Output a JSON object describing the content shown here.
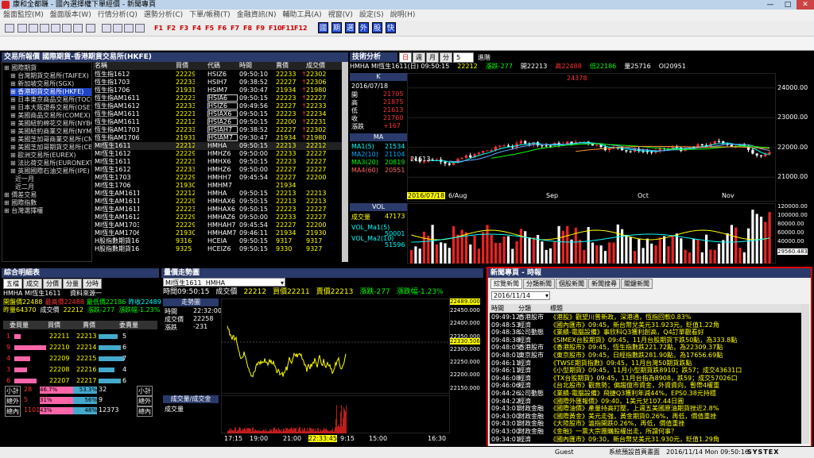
{
  "window": {
    "title": "康和全都賺 - 國內選擇權下單經價 - 新聞專頁",
    "min": "—",
    "max": "□",
    "close": "✕"
  },
  "menu": [
    "盤面監控(M)",
    "盤面版本(W)",
    "行情分析(Q)",
    "選勢分析(C)",
    "下單/帳務(T)",
    "金融資訊(N)",
    "輔助工具(A)",
    "視窗(V)",
    "設定(S)",
    "說明(H)"
  ],
  "fkeys": [
    "F1",
    "F2",
    "F3",
    "F4",
    "F5",
    "F6",
    "F7",
    "F8",
    "F9",
    "F10",
    "F11",
    "F12"
  ],
  "blue_buttons": [
    "國",
    "期",
    "選",
    "外",
    "股",
    "快"
  ],
  "left_panel": {
    "title": "交易所報價  國際期貨-香港期貨交易所(HKFE)",
    "tree": [
      "國際期貨",
      "台灣期貨交易所(TAIFEX)",
      "新加坡交易所(SGX)",
      "香港期貨交易所(HKFE)",
      "日本東京商品交易所(TOCOM)",
      "日本大阪證券交易所(OSE)",
      "美國商品交易所(COMEX)",
      "美國紐約棉花交易所(NYBOT)",
      "美國紐約商業交易所(NYMEX)",
      "美國芝加哥商業交易所(CME)",
      "美國芝加哥期貨交易所(CBOT)",
      "歐洲交易所(EUREX)",
      "法比荷交易所(EURONEXT)",
      "英國國際石油交易所(IPE)",
      "近一月",
      "近二月",
      "價差交易",
      "國際指數",
      "台灣選擇權"
    ],
    "headers": [
      "名稱",
      "買價",
      "代碼",
      "時間",
      "賣價",
      "成交價"
    ],
    "rows": [
      [
        "恆生指1612",
        "22229",
        "HSIZ6",
        "09:50:10",
        "22233",
        "22302"
      ],
      [
        "恆生指1703",
        "22233",
        "HSIH7",
        "09:38:52",
        "22227",
        "22306"
      ],
      [
        "恆生指1706",
        "21931",
        "HSIM7",
        "09:30:47",
        "21934",
        "21980"
      ],
      [
        "恆生指AM1611",
        "22223",
        "HSIA6",
        "09:50:15",
        "22223",
        "22227"
      ],
      [
        "恆生指AM1612",
        "22233",
        "HSIZ6",
        "09:49:56",
        "22227",
        "22233"
      ],
      [
        "恆生指AM1611",
        "22221",
        "HSIAX6",
        "09:50:15",
        "22223",
        "22234"
      ],
      [
        "恆生指AM1611",
        "22212",
        "HSIA26",
        "09:50:15",
        "22200",
        "22231"
      ],
      [
        "恆生指AM1703",
        "22233",
        "HSIAH7",
        "09:38:52",
        "22227",
        "22302"
      ],
      [
        "恆生指AM1706",
        "21931",
        "HSIAM7",
        "09:30:47",
        "21934",
        "21980"
      ],
      [
        "MI恆生1611",
        "22212",
        "HMHA",
        "09:50:15",
        "22213",
        "22212"
      ],
      [
        "MI恆生1612",
        "22229",
        "HMHZ6",
        "09:50:00",
        "22233",
        "22227"
      ],
      [
        "MI恆生1611",
        "22223",
        "HMHX6",
        "09:50:15",
        "22223",
        "22227"
      ],
      [
        "MI恆生1612",
        "22233",
        "HMHZ6",
        "09:50:00",
        "22227",
        "22227"
      ],
      [
        "MI恆生1703",
        "22229",
        "HMHH7",
        "09:45:54",
        "22227",
        "22200"
      ],
      [
        "MI恆生1706",
        "21930",
        "HMHM7",
        "",
        "21934",
        ""
      ],
      [
        "MI恆生AM1611",
        "22212",
        "HMHA",
        "09:50:15",
        "22213",
        "22213"
      ],
      [
        "MI恆生AM1611",
        "22229",
        "HMHAX6",
        "09:50:15",
        "22213",
        "22213"
      ],
      [
        "MI恆生AM1611",
        "22223",
        "HMHAX6",
        "09:50:15",
        "22223",
        "22227"
      ],
      [
        "MI恆生AM1612",
        "22229",
        "HMHAZ6",
        "09:50:00",
        "22233",
        "22227"
      ],
      [
        "MI恆生AM1703",
        "22229",
        "HMHAH7",
        "09:45:54",
        "22227",
        "22200"
      ],
      [
        "MI恆生AM1706",
        "21930",
        "HMHAM7",
        "09:46:11",
        "21934",
        "21930"
      ],
      [
        "H股指數期貨1611",
        "9316",
        "HCEIA",
        "09:50:15",
        "9317",
        "9317"
      ],
      [
        "H股指數期貨1612",
        "9325",
        "HCEIZ6",
        "09:50:15",
        "9330",
        "9327"
      ]
    ]
  },
  "tech": {
    "title": "技術分析",
    "tabs": [
      "日",
      "週",
      "月",
      "分"
    ],
    "period": "5",
    "type": "進階",
    "info": [
      "HMHA  MI恆生1611(日)  09:50:15",
      "22212",
      "漲跌-277",
      "開22213",
      "高22488",
      "低22186",
      "量25716",
      "OI20951"
    ],
    "sidebar": {
      "date": "2016/07/18",
      "ohlc": [
        "開",
        "高",
        "低",
        "收",
        "漲跌"
      ],
      "vals": [
        "21705",
        "21875",
        "21613",
        "21760",
        "+167"
      ],
      "ma_title": "MA",
      "ma": [
        "MA1(5)",
        "MA2(10)",
        "MA3(20)",
        "MA4(60)"
      ],
      "ma_vals": [
        "21534",
        "21104",
        "20819",
        "20551"
      ],
      "vol_title": "VOL",
      "vol": [
        "成交量",
        "VOL_Ma1(5)",
        "VOL_Ma2(10)"
      ],
      "vol_vals": [
        "47173",
        "50001",
        "51596"
      ]
    },
    "yaxis": [
      "24000.00",
      "23000.00",
      "22000.00",
      "21000.00"
    ],
    "xaxis": [
      "6/Aug",
      "Sep",
      "Oct",
      "Nov"
    ],
    "cursor_date": "2016/07/18",
    "hi_label": "24378",
    "lo_label": "21613",
    "vol_axis": [
      "120000.00",
      "100000.00",
      "80000.00",
      "60000.00",
      "40000.00",
      "29560.483"
    ]
  },
  "summary": {
    "title": "綜合明細表",
    "tabs": [
      "五檔",
      "成交",
      "分價",
      "分量",
      "分時"
    ],
    "source": "資料來源一",
    "line1": "HMHA  MI恆生1611",
    "line2a": "開盤價22488",
    "line2b": "最高價22488",
    "line2c": "最低價22186",
    "line2d": "昨收22489",
    "line3a": "昨量64370",
    "line3b": "成交價",
    "line3c": "22212",
    "line3d": "漲跌-277",
    "line3e": "漲跌幅-1.23%",
    "hdr": [
      "委買量",
      "買價",
      "賣價",
      "委賣量"
    ],
    "bids": [
      [
        "1",
        "22211",
        "22213",
        "5"
      ],
      [
        "9",
        "22210",
        "22214",
        "6"
      ],
      [
        "4",
        "22209",
        "22215",
        "7"
      ],
      [
        "3",
        "22208",
        "22216",
        "4"
      ],
      [
        "6",
        "22207",
        "22217",
        "6"
      ]
    ],
    "tot": [
      [
        "小計",
        "28",
        "46.7%",
        "53.3%",
        "32",
        "小計"
      ],
      [
        "總外",
        "5",
        "31%",
        "56%",
        "9",
        "總外"
      ],
      [
        "總內",
        "11013",
        "43%",
        "48%",
        "12373",
        "總內"
      ]
    ]
  },
  "tick": {
    "title": "量價走勢圖",
    "symbol": "MI恆生1611",
    "code": "HMHA",
    "info": [
      "時間09:50:15",
      "成交價",
      "22212",
      "買價22211",
      "賣價22213",
      "漲跌-277",
      "漲跌幅-1.23%"
    ],
    "box_title": "走勢圖",
    "box": [
      [
        "時間",
        "22:32:00"
      ],
      [
        "成交價",
        "22258"
      ],
      [
        "漲跌",
        "-231"
      ]
    ],
    "yaxis": [
      "22489.000",
      "22450.000",
      "22400.000",
      "22350.000",
      "22330.506",
      "22300.000",
      "22250.000",
      "22200.000",
      "22150.000"
    ],
    "vol_title": "成交量/成交金",
    "vol_label": "成交量",
    "xaxis": [
      "17:15",
      "19:00",
      "21:00",
      "22:33:45",
      "9:15",
      "15:00",
      "16:30"
    ]
  },
  "news": {
    "title": "新聞專頁 - 時報",
    "tabs": [
      "綜覽新聞",
      "分類新聞",
      "個股新聞",
      "新聞搜尋",
      "關鍵新聞"
    ],
    "date": "2016/11/14",
    "hdr": [
      "時間",
      "分類",
      "標題"
    ],
    "items": [
      [
        "09:49:12",
        "香港股市",
        "《港股》觀望川普新政，深港通，恆指回軟0.83%"
      ],
      [
        "09:48:53",
        "經濟",
        "《國內匯市》09:45，新台幣兌美元31.923元，貶值1.22角"
      ],
      [
        "09:48:38",
        "公司動態",
        "《業績-電腦設備》事欣科Q3獲利創高，Q4訂單觀看好"
      ],
      [
        "09:48:38",
        "經濟",
        "《SIMEX台股期貨》09:45，11月台股期貨下跌50點，為333.8點"
      ],
      [
        "09:48:05",
        "香港股市",
        "《香港股市》09:45，恆生指數跌221.72點，為22309.37點"
      ],
      [
        "09:48:01",
        "東京股市",
        "《東京股市》09:45，日經指數跌281.90點，為17656.69點"
      ],
      [
        "09:46:11",
        "經濟",
        "《TWSE期貨指數》09:45，11月台灣50期貨跌點"
      ],
      [
        "09:46:11",
        "經濟",
        "《小型期貨》09:45，11月小型期貨跌8910；跌57；成交43631口"
      ],
      [
        "09:46:08",
        "經濟",
        "《TX台股期貨》09:45，11月台指為8908，跌59；成交57026口"
      ],
      [
        "09:46:06",
        "經濟",
        "《台北股市》觀竟勢；偏趨億市資金，外資資向，暫帶4權重"
      ],
      [
        "09:44:26",
        "公司動態",
        "《業績-電腦設備》飛捷Q3獲利年減44%，EPS0.38元持穩"
      ],
      [
        "09:44:22",
        "經濟",
        "《國際外匯報價》09:40，1美元兌107.44日圓"
      ],
      [
        "09:43:01",
        "財政金融",
        "《國際油價》產量持高打壓，上週五美國原油期貨挫近2.8%"
      ],
      [
        "09:43:00",
        "財政金融",
        "《國際黃金》美元走強，黃金期貨0.26%，再低，價值重挫"
      ],
      [
        "09:43:01",
        "財政金融",
        "《大陸股市》滬指開跌0.26%，再低，價值重挫"
      ],
      [
        "09:43:00",
        "財政金融",
        "《金融》一票大宗團購股權出走，所謂何事？"
      ],
      [
        "09:34:01",
        "經濟",
        "《國內匯市》09:30，新台幣兌美元31.930元，貶值1.29角"
      ]
    ]
  },
  "status": {
    "user": "Guest",
    "center": "系統預設首頁畫面",
    "datetime": "2016/11/14 Mon 09:50:16",
    "brand": "SYSTEX"
  },
  "colors": {
    "panel_title": "#2a3a6a",
    "up": "#ff3333",
    "down": "#00ff00",
    "price": "#ffff00"
  }
}
